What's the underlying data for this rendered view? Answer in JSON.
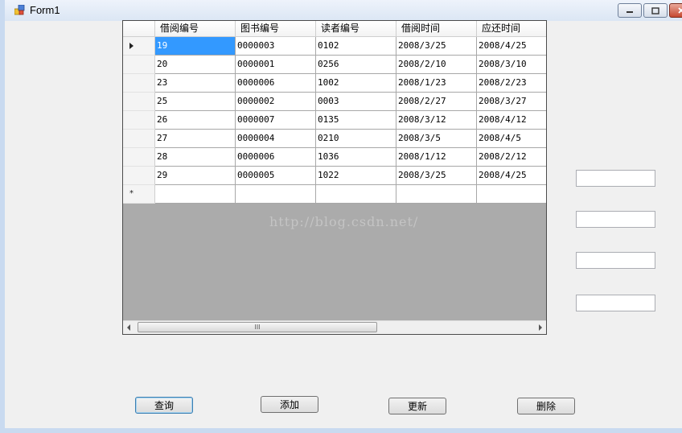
{
  "window": {
    "title": "Form1"
  },
  "grid": {
    "columns": [
      "借阅编号",
      "图书编号",
      "读者编号",
      "借阅时间",
      "应还时间"
    ],
    "rows": [
      [
        "19",
        "0000003",
        "0102",
        "2008/3/25",
        "2008/4/25"
      ],
      [
        "20",
        "0000001",
        "0256",
        "2008/2/10",
        "2008/3/10"
      ],
      [
        "23",
        "0000006",
        "1002",
        "2008/1/23",
        "2008/2/23"
      ],
      [
        "25",
        "0000002",
        "0003",
        "2008/2/27",
        "2008/3/27"
      ],
      [
        "26",
        "0000007",
        "0135",
        "2008/3/12",
        "2008/4/12"
      ],
      [
        "27",
        "0000004",
        "0210",
        "2008/3/5",
        "2008/4/5"
      ],
      [
        "28",
        "0000006",
        "1036",
        "2008/1/12",
        "2008/2/12"
      ],
      [
        "29",
        "0000005",
        "1022",
        "2008/3/25",
        "2008/4/25"
      ]
    ],
    "new_row_marker": "*",
    "scroll_thumb_grip": "III"
  },
  "watermark": "http://blog.csdn.net/",
  "textboxes": [
    "",
    "",
    "",
    ""
  ],
  "buttons": {
    "query": "查询",
    "add": "添加",
    "update": "更新",
    "delete": "删除"
  },
  "colors": {
    "selection": "#3399ff",
    "grid_background": "#ababab",
    "window_background": "#f0f0f0"
  }
}
